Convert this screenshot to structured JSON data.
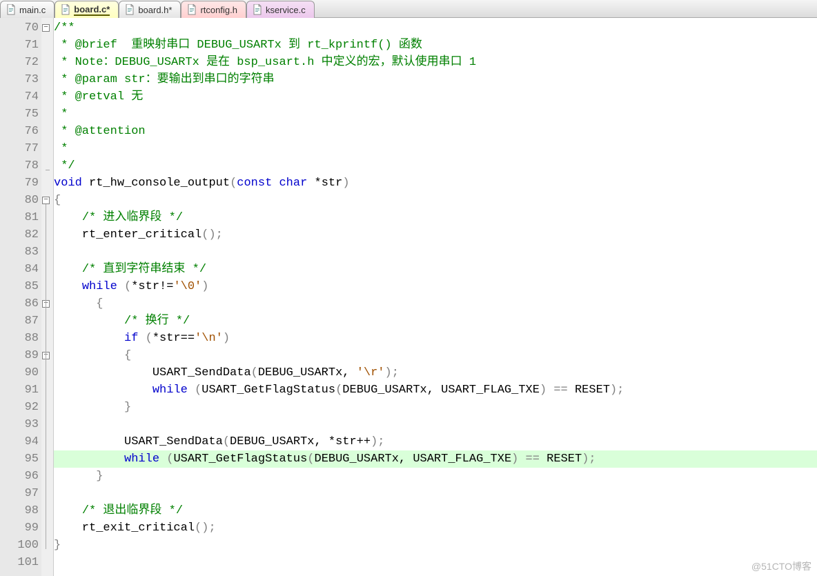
{
  "tabs": [
    {
      "label": "main.c",
      "kind": "plain"
    },
    {
      "label": "board.c*",
      "kind": "active"
    },
    {
      "label": "board.h*",
      "kind": "plain"
    },
    {
      "label": "rtconfig.h",
      "kind": "pink1"
    },
    {
      "label": "kservice.c",
      "kind": "pink2"
    }
  ],
  "lines": {
    "start": 70,
    "end": 101,
    "fold_open_at": [
      70,
      80,
      86,
      89
    ],
    "fold_end_at": [
      78
    ],
    "highlight": 95,
    "rows": [
      {
        "n": 70,
        "seg": [
          {
            "t": "/**",
            "c": "c-comment"
          }
        ]
      },
      {
        "n": 71,
        "seg": [
          {
            "t": " * @brief  重映射串口 DEBUG_USARTx 到 rt_kprintf() 函数",
            "c": "c-comment"
          }
        ]
      },
      {
        "n": 72,
        "seg": [
          {
            "t": " * Note：DEBUG_USARTx 是在 bsp_usart.h 中定义的宏，默认使用串口 1",
            "c": "c-comment"
          }
        ]
      },
      {
        "n": 73,
        "seg": [
          {
            "t": " * @param str：要输出到串口的字符串",
            "c": "c-comment"
          }
        ]
      },
      {
        "n": 74,
        "seg": [
          {
            "t": " * @retval 无",
            "c": "c-comment"
          }
        ]
      },
      {
        "n": 75,
        "seg": [
          {
            "t": " *",
            "c": "c-comment"
          }
        ]
      },
      {
        "n": 76,
        "seg": [
          {
            "t": " * @attention",
            "c": "c-comment"
          }
        ]
      },
      {
        "n": 77,
        "seg": [
          {
            "t": " *",
            "c": "c-comment"
          }
        ]
      },
      {
        "n": 78,
        "seg": [
          {
            "t": " */",
            "c": "c-comment"
          }
        ]
      },
      {
        "n": 79,
        "seg": [
          {
            "t": "void",
            "c": "c-keyword"
          },
          {
            "t": " rt_hw_console_output",
            "c": ""
          },
          {
            "t": "(",
            "c": "c-punct"
          },
          {
            "t": "const",
            "c": "c-keyword"
          },
          {
            "t": " ",
            "c": ""
          },
          {
            "t": "char",
            "c": "c-keyword"
          },
          {
            "t": " *str",
            "c": ""
          },
          {
            "t": ")",
            "c": "c-punct"
          }
        ]
      },
      {
        "n": 80,
        "seg": [
          {
            "t": "{",
            "c": "c-punct"
          }
        ]
      },
      {
        "n": 81,
        "seg": [
          {
            "t": "    ",
            "c": ""
          },
          {
            "t": "/* 进入临界段 */",
            "c": "c-comment"
          }
        ]
      },
      {
        "n": 82,
        "seg": [
          {
            "t": "    rt_enter_critical",
            "c": ""
          },
          {
            "t": "();",
            "c": "c-punct"
          }
        ]
      },
      {
        "n": 83,
        "seg": [
          {
            "t": "",
            "c": ""
          }
        ]
      },
      {
        "n": 84,
        "seg": [
          {
            "t": "    ",
            "c": ""
          },
          {
            "t": "/* 直到字符串结束 */",
            "c": "c-comment"
          }
        ]
      },
      {
        "n": 85,
        "seg": [
          {
            "t": "    ",
            "c": ""
          },
          {
            "t": "while",
            "c": "c-keyword"
          },
          {
            "t": " ",
            "c": ""
          },
          {
            "t": "(",
            "c": "c-punct"
          },
          {
            "t": "*str!=",
            "c": ""
          },
          {
            "t": "'\\0'",
            "c": "c-string"
          },
          {
            "t": ")",
            "c": "c-punct"
          }
        ]
      },
      {
        "n": 86,
        "seg": [
          {
            "t": "      {",
            "c": "c-punct"
          }
        ]
      },
      {
        "n": 87,
        "seg": [
          {
            "t": "          ",
            "c": ""
          },
          {
            "t": "/* 换行 */",
            "c": "c-comment"
          }
        ]
      },
      {
        "n": 88,
        "seg": [
          {
            "t": "          ",
            "c": ""
          },
          {
            "t": "if",
            "c": "c-keyword"
          },
          {
            "t": " ",
            "c": ""
          },
          {
            "t": "(",
            "c": "c-punct"
          },
          {
            "t": "*str==",
            "c": ""
          },
          {
            "t": "'\\n'",
            "c": "c-string"
          },
          {
            "t": ")",
            "c": "c-punct"
          }
        ]
      },
      {
        "n": 89,
        "seg": [
          {
            "t": "          {",
            "c": "c-punct"
          }
        ]
      },
      {
        "n": 90,
        "seg": [
          {
            "t": "              USART_SendData",
            "c": ""
          },
          {
            "t": "(",
            "c": "c-punct"
          },
          {
            "t": "DEBUG_USARTx, ",
            "c": ""
          },
          {
            "t": "'\\r'",
            "c": "c-string"
          },
          {
            "t": ");",
            "c": "c-punct"
          }
        ]
      },
      {
        "n": 91,
        "seg": [
          {
            "t": "              ",
            "c": ""
          },
          {
            "t": "while",
            "c": "c-keyword"
          },
          {
            "t": " ",
            "c": ""
          },
          {
            "t": "(",
            "c": "c-punct"
          },
          {
            "t": "USART_GetFlagStatus",
            "c": ""
          },
          {
            "t": "(",
            "c": "c-punct"
          },
          {
            "t": "DEBUG_USARTx, USART_FLAG_TXE",
            "c": ""
          },
          {
            "t": ") == ",
            "c": "c-punct"
          },
          {
            "t": "RESET",
            "c": ""
          },
          {
            "t": ");",
            "c": "c-punct"
          }
        ]
      },
      {
        "n": 92,
        "seg": [
          {
            "t": "          }",
            "c": "c-punct"
          }
        ]
      },
      {
        "n": 93,
        "seg": [
          {
            "t": "",
            "c": ""
          }
        ]
      },
      {
        "n": 94,
        "seg": [
          {
            "t": "          USART_SendData",
            "c": ""
          },
          {
            "t": "(",
            "c": "c-punct"
          },
          {
            "t": "DEBUG_USARTx, *str++",
            "c": ""
          },
          {
            "t": ");",
            "c": "c-punct"
          }
        ]
      },
      {
        "n": 95,
        "seg": [
          {
            "t": "          ",
            "c": ""
          },
          {
            "t": "while",
            "c": "c-keyword"
          },
          {
            "t": " ",
            "c": ""
          },
          {
            "t": "(",
            "c": "c-punct"
          },
          {
            "t": "USART_GetFlagStatus",
            "c": ""
          },
          {
            "t": "(",
            "c": "c-punct"
          },
          {
            "t": "DEBUG_USARTx, USART_FLAG_TXE",
            "c": ""
          },
          {
            "t": ") == ",
            "c": "c-punct"
          },
          {
            "t": "RESET",
            "c": ""
          },
          {
            "t": ");",
            "c": "c-punct"
          }
        ]
      },
      {
        "n": 96,
        "seg": [
          {
            "t": "      }",
            "c": "c-punct"
          }
        ]
      },
      {
        "n": 97,
        "seg": [
          {
            "t": "",
            "c": ""
          }
        ]
      },
      {
        "n": 98,
        "seg": [
          {
            "t": "    ",
            "c": ""
          },
          {
            "t": "/* 退出临界段 */",
            "c": "c-comment"
          }
        ]
      },
      {
        "n": 99,
        "seg": [
          {
            "t": "    rt_exit_critical",
            "c": ""
          },
          {
            "t": "();",
            "c": "c-punct"
          }
        ]
      },
      {
        "n": 100,
        "seg": [
          {
            "t": "}",
            "c": "c-punct"
          }
        ]
      },
      {
        "n": 101,
        "seg": [
          {
            "t": "",
            "c": ""
          }
        ]
      }
    ]
  },
  "watermark": "@51CTO博客"
}
